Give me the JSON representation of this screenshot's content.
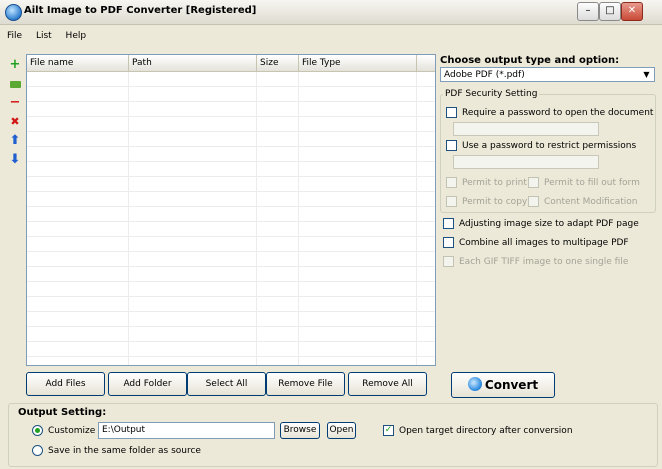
{
  "window": {
    "title": "Ailt Image to PDF Converter [Registered]",
    "controls": {
      "minimize": "–",
      "maximize": "□",
      "close": "✕"
    }
  },
  "menu": [
    "File",
    "List",
    "Help"
  ],
  "toolbar_icons": [
    "plus-icon",
    "folder-icon",
    "minus-icon",
    "delete-icon",
    "up-arrow-icon",
    "down-arrow-icon"
  ],
  "file_list": {
    "columns": [
      "File name",
      "Path",
      "Size",
      "File Type"
    ],
    "rows": []
  },
  "buttons": {
    "add_files": "Add Files",
    "add_folder": "Add Folder",
    "select_all": "Select All",
    "remove_file": "Remove File",
    "remove_all": "Remove All",
    "convert": "Convert"
  },
  "output_type": {
    "label": "Choose output type and option:",
    "selected": "Adobe PDF (*.pdf)"
  },
  "security": {
    "title": "PDF Security Setting",
    "require_open_password": {
      "label": "Require a password to open the document",
      "checked": false
    },
    "restrict_password": {
      "label": "Use a password to restrict permissions",
      "checked": false
    },
    "permissions": {
      "print": "Permit to print",
      "fill_form": "Permit to fill out form",
      "copy": "Permit to copy",
      "modify": "Content Modification"
    }
  },
  "options": {
    "adjust_size": {
      "label": "Adjusting image size to adapt PDF page",
      "checked": false
    },
    "combine": {
      "label": "Combine all images to multipage PDF",
      "checked": false
    },
    "gif_tiff": {
      "label": "Each GIF TIFF image to one single file",
      "checked": false,
      "disabled": true
    }
  },
  "output_setting": {
    "title": "Output Setting:",
    "customize_label": "Customize",
    "path": "E:\\Output",
    "browse": "Browse",
    "open": "Open",
    "open_after": {
      "label": "Open target directory after conversion",
      "checked": true,
      "mark": "✓"
    },
    "same_folder_label": "Save in the same folder as source"
  },
  "colors": {
    "accent_green": "#21a121",
    "toolbar_red": "#d01818",
    "toolbar_blue": "#1f5fd0"
  }
}
